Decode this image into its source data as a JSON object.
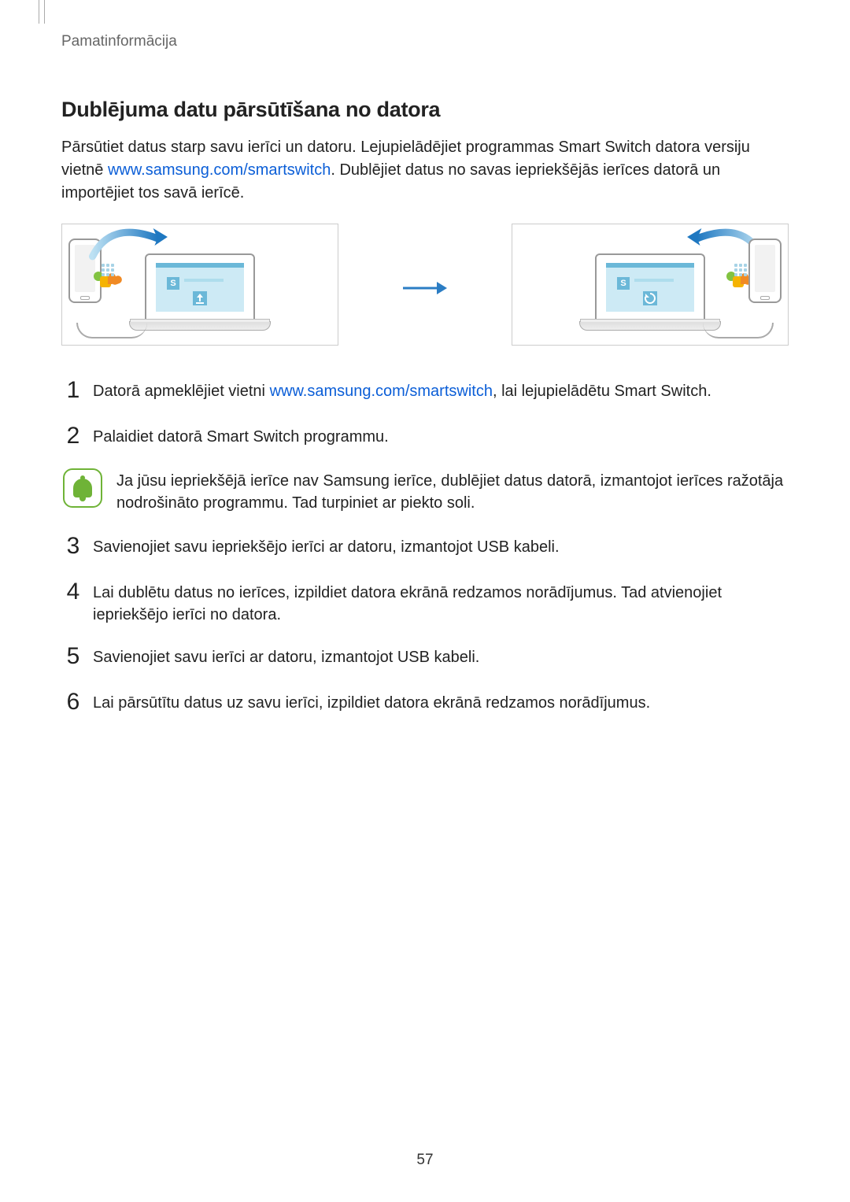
{
  "header_label": "Pamatinformācija",
  "section_title": "Dublējuma datu pārsūtīšana no datora",
  "intro": {
    "text1": "Pārsūtiet datus starp savu ierīci un datoru. Lejupielādējiet programmas Smart Switch datora versiju vietnē ",
    "link1": "www.samsung.com/smartswitch",
    "text2": ". Dublējiet datus no savas iepriekšējās ierīces datorā un importējiet tos savā ierīcē."
  },
  "steps": {
    "s1": {
      "text1": "Datorā apmeklējiet vietni ",
      "link": "www.samsung.com/smartswitch",
      "text2": ", lai lejupielādētu Smart Switch."
    },
    "s2": "Palaidiet datorā Smart Switch programmu.",
    "s3": "Savienojiet savu iepriekšējo ierīci ar datoru, izmantojot USB kabeli.",
    "s4": "Lai dublētu datus no ierīces, izpildiet datora ekrānā redzamos norādījumus. Tad atvienojiet iepriekšējo ierīci no datora.",
    "s5": "Savienojiet savu ierīci ar datoru, izmantojot USB kabeli.",
    "s6": "Lai pārsūtītu datus uz savu ierīci, izpildiet datora ekrānā redzamos norādījumus."
  },
  "note_text": "Ja jūsu iepriekšējā ierīce nav Samsung ierīce, dublējiet datus datorā, izmantojot ierīces ražotāja nodrošināto programmu. Tad turpiniet ar piekto soli.",
  "page_number": "57",
  "colors": {
    "link": "#0b5ed7",
    "note_green": "#6fb337"
  }
}
